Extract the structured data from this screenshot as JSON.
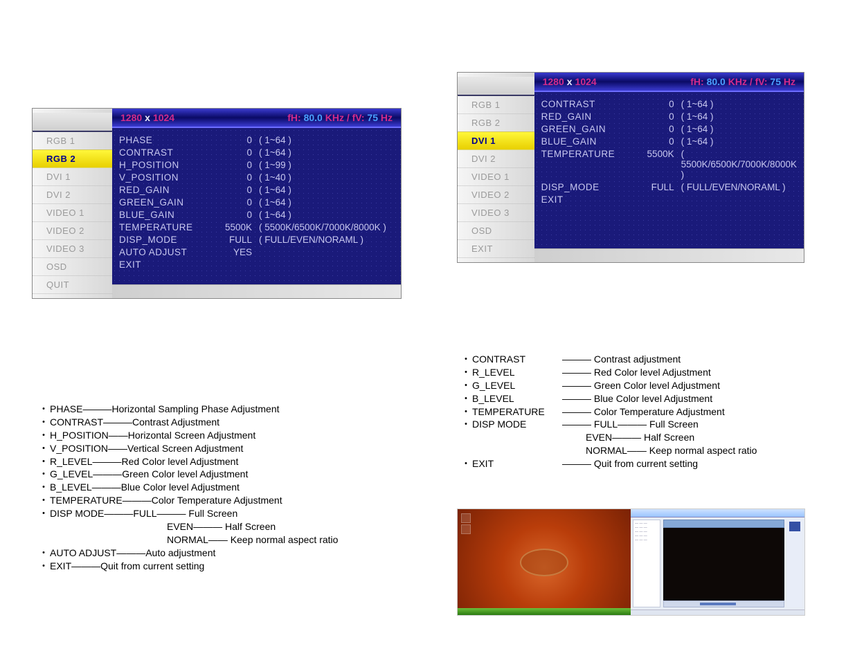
{
  "panel1": {
    "resW": "1280",
    "resH": "1024",
    "fhLabel": "fH:",
    "fh": "80.0",
    "fhUnit": "KHz / fV:",
    "fv": "75",
    "fvUnit": "Hz",
    "nav": [
      "RGB 1",
      "RGB 2",
      "DVI 1",
      "DVI 2",
      "VIDEO 1",
      "VIDEO 2",
      "VIDEO 3",
      "OSD",
      "QUIT"
    ],
    "selected": 1,
    "rows": [
      {
        "name": "PHASE",
        "val": "0",
        "opts": "( 1~64 )"
      },
      {
        "name": "CONTRAST",
        "val": "0",
        "opts": "( 1~64 )"
      },
      {
        "name": "H_POSITION",
        "val": "0",
        "opts": "( 1~99 )"
      },
      {
        "name": "V_POSITION",
        "val": "0",
        "opts": "( 1~40 )"
      },
      {
        "name": "RED_GAIN",
        "val": "0",
        "opts": "( 1~64 )"
      },
      {
        "name": "GREEN_GAIN",
        "val": "0",
        "opts": "( 1~64 )"
      },
      {
        "name": "BLUE_GAIN",
        "val": "0",
        "opts": "( 1~64 )"
      },
      {
        "name": "TEMPERATURE",
        "val": "5500K",
        "opts": "( 5500K/6500K/7000K/8000K )"
      },
      {
        "name": "DISP_MODE",
        "val": "FULL",
        "opts": "( FULL/EVEN/NORAML )"
      },
      {
        "name": "AUTO ADJUST",
        "val": "YES",
        "opts": ""
      },
      {
        "name": "EXIT",
        "val": "",
        "opts": ""
      }
    ]
  },
  "panel2": {
    "resW": "1280",
    "resH": "1024",
    "fhLabel": "fH:",
    "fh": "80.0",
    "fhUnit": "KHz / fV:",
    "fv": "75",
    "fvUnit": "Hz",
    "nav": [
      "RGB 1",
      "RGB 2",
      "DVI 1",
      "DVI 2",
      "VIDEO 1",
      "VIDEO 2",
      "VIDEO 3",
      "OSD",
      "EXIT"
    ],
    "selected": 2,
    "rows": [
      {
        "name": "CONTRAST",
        "val": "0",
        "opts": "( 1~64 )"
      },
      {
        "name": "RED_GAIN",
        "val": "0",
        "opts": "( 1~64 )"
      },
      {
        "name": "GREEN_GAIN",
        "val": "0",
        "opts": "( 1~64 )"
      },
      {
        "name": "BLUE_GAIN",
        "val": "0",
        "opts": "( 1~64 )"
      },
      {
        "name": "TEMPERATURE",
        "val": "5500K",
        "opts": "( 5500K/6500K/7000K/8000K )"
      },
      {
        "name": "DISP_MODE",
        "val": "FULL",
        "opts": "( FULL/EVEN/NORAML )"
      },
      {
        "name": "EXIT",
        "val": "",
        "opts": ""
      }
    ]
  },
  "desc1": [
    {
      "bullet": "・",
      "term": "PHASE",
      "dash": "———",
      "rest": " Horizontal Sampling Phase Adjustment"
    },
    {
      "bullet": "・",
      "term": "CONTRAST",
      "dash": "———",
      "rest": " Contrast Adjustment"
    },
    {
      "bullet": "・",
      "term": "H_POSITION",
      "dash": "——",
      "rest": " Horizontal Screen Adjustment"
    },
    {
      "bullet": "・",
      "term": "V_POSITION",
      "dash": "——",
      "rest": " Vertical Screen Adjustment"
    },
    {
      "bullet": "・",
      "term": "R_LEVEL",
      "dash": "———",
      "rest": " Red Color level Adjustment"
    },
    {
      "bullet": "・",
      "term": "G_LEVEL",
      "dash": "———",
      "rest": " Green Color level Adjustment"
    },
    {
      "bullet": "・",
      "term": "B_LEVEL",
      "dash": "———",
      "rest": " Blue Color level Adjustment"
    },
    {
      "bullet": "・",
      "term": "TEMPERATURE",
      "dash": "———",
      "rest": " Color Temperature Adjustment"
    },
    {
      "bullet": "・",
      "term": "DISP MODE",
      "dash": "———",
      "rest": "FULL——— Full Screen"
    },
    {
      "cont": "EVEN——— Half Screen"
    },
    {
      "cont": "NORMAL—— Keep normal aspect ratio"
    },
    {
      "bullet": "・",
      "term": "AUTO ADJUST",
      "dash": "———",
      "rest": " Auto adjustment"
    },
    {
      "bullet": "・",
      "term": "EXIT",
      "dash": "———",
      "rest": " Quit from current setting"
    }
  ],
  "desc2": [
    {
      "bullet": "・",
      "term": "CONTRAST",
      "dash": "",
      "termW": "130px",
      "rest": "——— Contrast adjustment"
    },
    {
      "bullet": "・",
      "term": "R_LEVEL",
      "dash": "",
      "termW": "130px",
      "rest": "——— Red Color level Adjustment"
    },
    {
      "bullet": "・",
      "term": "G_LEVEL",
      "dash": "",
      "termW": "130px",
      "rest": "——— Green Color level Adjustment"
    },
    {
      "bullet": "・",
      "term": "B_LEVEL",
      "dash": "",
      "termW": "130px",
      "rest": "——— Blue Color level Adjustment"
    },
    {
      "bullet": "・",
      "term": "TEMPERATURE",
      "dash": "",
      "termW": "130px",
      "rest": "——— Color Temperature Adjustment"
    },
    {
      "bullet": "・",
      "term": "DISP MODE",
      "dash": "",
      "termW": "130px",
      "rest": "———  FULL——— Full Screen"
    },
    {
      "cont2": "EVEN——— Half Screen"
    },
    {
      "cont2": "NORMAL—— Keep normal aspect ratio"
    },
    {
      "bullet": "・",
      "term": "EXIT",
      "dash": "",
      "termW": "130px",
      "rest": "———    Quit from current setting"
    }
  ]
}
